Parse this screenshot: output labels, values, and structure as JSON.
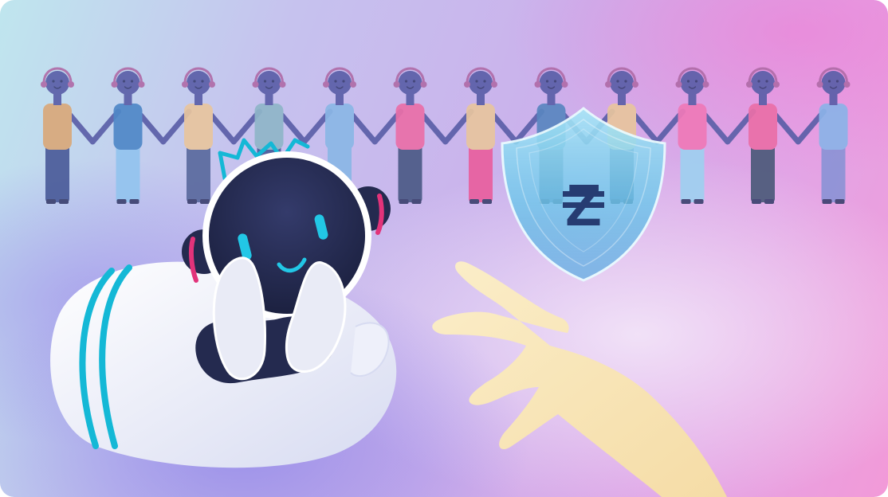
{
  "illustration": {
    "shield_letter": "Z",
    "people_count": 12,
    "colors": {
      "skin": "#5b5fa8",
      "hand": "#f8e6b8",
      "robot_face": "#242a4f",
      "robot_body": "#f0f2fb",
      "accent_cyan": "#14b8d6",
      "accent_pink": "#e2337a",
      "shield": "#7fd3ee"
    },
    "people_shirts": [
      "#d9a97a",
      "#4f88c7",
      "#e8c59e",
      "#8fb6c9",
      "#8bb7e6",
      "#ea6fa8",
      "#e8c59e",
      "#5a86c0",
      "#e8c59e",
      "#ef79b8",
      "#ea6fa8",
      "#8bb3e8"
    ],
    "people_pants": [
      "#4b5c9a",
      "#93c4ee",
      "#5a6a9e",
      "#4b5c9a",
      "#8bb7e6",
      "#4c5a86",
      "#e95f9e",
      "#5b6aa0",
      "#4b5c9a",
      "#9fd0f0",
      "#4c5a7a",
      "#8c93d6"
    ]
  }
}
